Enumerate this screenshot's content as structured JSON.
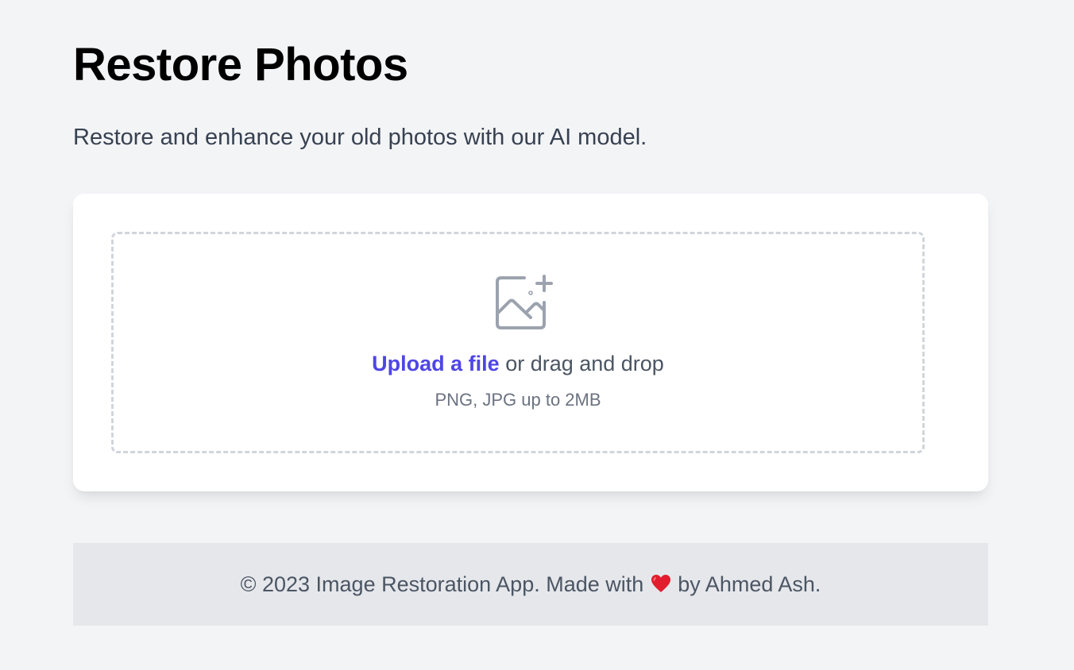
{
  "header": {
    "title": "Restore Photos",
    "subtitle": "Restore and enhance your old photos with our AI model."
  },
  "upload": {
    "icon": "image-add-icon",
    "link_label": "Upload a file",
    "drag_text": " or drag and drop",
    "hint": "PNG, JPG up to 2MB"
  },
  "footer": {
    "text_before": "© 2023 Image Restoration App. Made with ",
    "icon": "heart-icon",
    "text_after": " by Ahmed Ash."
  },
  "colors": {
    "background": "#f3f4f6",
    "card": "#ffffff",
    "link": "#4f46e5",
    "footer_bg": "#e5e7eb",
    "heart": "#e11d2e"
  }
}
